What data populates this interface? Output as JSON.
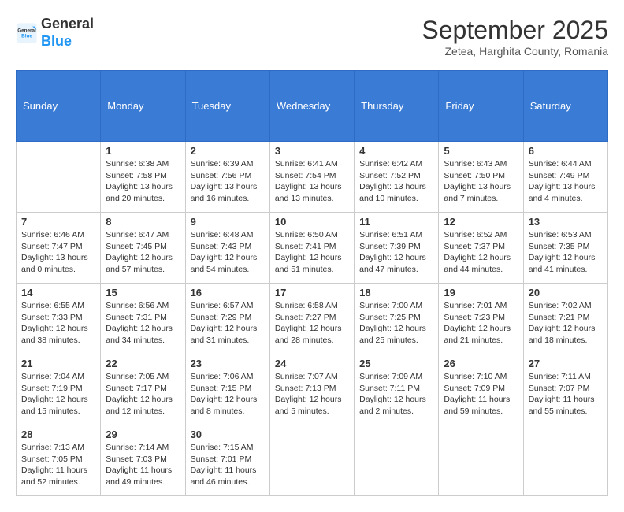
{
  "logo": {
    "line1": "General",
    "line2": "Blue"
  },
  "title": "September 2025",
  "subtitle": "Zetea, Harghita County, Romania",
  "weekdays": [
    "Sunday",
    "Monday",
    "Tuesday",
    "Wednesday",
    "Thursday",
    "Friday",
    "Saturday"
  ],
  "weeks": [
    [
      {
        "day": "",
        "info": ""
      },
      {
        "day": "1",
        "info": "Sunrise: 6:38 AM\nSunset: 7:58 PM\nDaylight: 13 hours\nand 20 minutes."
      },
      {
        "day": "2",
        "info": "Sunrise: 6:39 AM\nSunset: 7:56 PM\nDaylight: 13 hours\nand 16 minutes."
      },
      {
        "day": "3",
        "info": "Sunrise: 6:41 AM\nSunset: 7:54 PM\nDaylight: 13 hours\nand 13 minutes."
      },
      {
        "day": "4",
        "info": "Sunrise: 6:42 AM\nSunset: 7:52 PM\nDaylight: 13 hours\nand 10 minutes."
      },
      {
        "day": "5",
        "info": "Sunrise: 6:43 AM\nSunset: 7:50 PM\nDaylight: 13 hours\nand 7 minutes."
      },
      {
        "day": "6",
        "info": "Sunrise: 6:44 AM\nSunset: 7:49 PM\nDaylight: 13 hours\nand 4 minutes."
      }
    ],
    [
      {
        "day": "7",
        "info": "Sunrise: 6:46 AM\nSunset: 7:47 PM\nDaylight: 13 hours\nand 0 minutes."
      },
      {
        "day": "8",
        "info": "Sunrise: 6:47 AM\nSunset: 7:45 PM\nDaylight: 12 hours\nand 57 minutes."
      },
      {
        "day": "9",
        "info": "Sunrise: 6:48 AM\nSunset: 7:43 PM\nDaylight: 12 hours\nand 54 minutes."
      },
      {
        "day": "10",
        "info": "Sunrise: 6:50 AM\nSunset: 7:41 PM\nDaylight: 12 hours\nand 51 minutes."
      },
      {
        "day": "11",
        "info": "Sunrise: 6:51 AM\nSunset: 7:39 PM\nDaylight: 12 hours\nand 47 minutes."
      },
      {
        "day": "12",
        "info": "Sunrise: 6:52 AM\nSunset: 7:37 PM\nDaylight: 12 hours\nand 44 minutes."
      },
      {
        "day": "13",
        "info": "Sunrise: 6:53 AM\nSunset: 7:35 PM\nDaylight: 12 hours\nand 41 minutes."
      }
    ],
    [
      {
        "day": "14",
        "info": "Sunrise: 6:55 AM\nSunset: 7:33 PM\nDaylight: 12 hours\nand 38 minutes."
      },
      {
        "day": "15",
        "info": "Sunrise: 6:56 AM\nSunset: 7:31 PM\nDaylight: 12 hours\nand 34 minutes."
      },
      {
        "day": "16",
        "info": "Sunrise: 6:57 AM\nSunset: 7:29 PM\nDaylight: 12 hours\nand 31 minutes."
      },
      {
        "day": "17",
        "info": "Sunrise: 6:58 AM\nSunset: 7:27 PM\nDaylight: 12 hours\nand 28 minutes."
      },
      {
        "day": "18",
        "info": "Sunrise: 7:00 AM\nSunset: 7:25 PM\nDaylight: 12 hours\nand 25 minutes."
      },
      {
        "day": "19",
        "info": "Sunrise: 7:01 AM\nSunset: 7:23 PM\nDaylight: 12 hours\nand 21 minutes."
      },
      {
        "day": "20",
        "info": "Sunrise: 7:02 AM\nSunset: 7:21 PM\nDaylight: 12 hours\nand 18 minutes."
      }
    ],
    [
      {
        "day": "21",
        "info": "Sunrise: 7:04 AM\nSunset: 7:19 PM\nDaylight: 12 hours\nand 15 minutes."
      },
      {
        "day": "22",
        "info": "Sunrise: 7:05 AM\nSunset: 7:17 PM\nDaylight: 12 hours\nand 12 minutes."
      },
      {
        "day": "23",
        "info": "Sunrise: 7:06 AM\nSunset: 7:15 PM\nDaylight: 12 hours\nand 8 minutes."
      },
      {
        "day": "24",
        "info": "Sunrise: 7:07 AM\nSunset: 7:13 PM\nDaylight: 12 hours\nand 5 minutes."
      },
      {
        "day": "25",
        "info": "Sunrise: 7:09 AM\nSunset: 7:11 PM\nDaylight: 12 hours\nand 2 minutes."
      },
      {
        "day": "26",
        "info": "Sunrise: 7:10 AM\nSunset: 7:09 PM\nDaylight: 11 hours\nand 59 minutes."
      },
      {
        "day": "27",
        "info": "Sunrise: 7:11 AM\nSunset: 7:07 PM\nDaylight: 11 hours\nand 55 minutes."
      }
    ],
    [
      {
        "day": "28",
        "info": "Sunrise: 7:13 AM\nSunset: 7:05 PM\nDaylight: 11 hours\nand 52 minutes."
      },
      {
        "day": "29",
        "info": "Sunrise: 7:14 AM\nSunset: 7:03 PM\nDaylight: 11 hours\nand 49 minutes."
      },
      {
        "day": "30",
        "info": "Sunrise: 7:15 AM\nSunset: 7:01 PM\nDaylight: 11 hours\nand 46 minutes."
      },
      {
        "day": "",
        "info": ""
      },
      {
        "day": "",
        "info": ""
      },
      {
        "day": "",
        "info": ""
      },
      {
        "day": "",
        "info": ""
      }
    ]
  ]
}
